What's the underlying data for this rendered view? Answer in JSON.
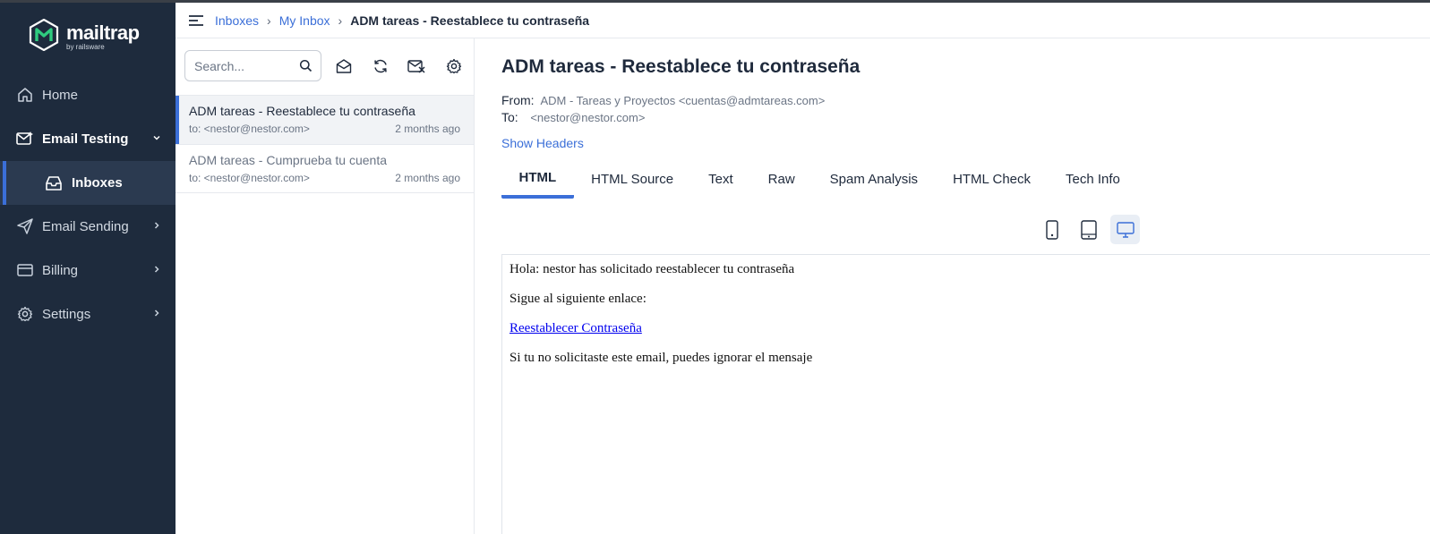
{
  "sidebar": {
    "logo": {
      "name": "mailtrap",
      "sub": "by railsware"
    },
    "items": [
      {
        "label": "Home",
        "icon": "home-icon"
      },
      {
        "label": "Email Testing",
        "icon": "email-testing-icon",
        "expanded": true
      },
      {
        "label": "Inboxes",
        "icon": "inbox-icon",
        "active": true
      },
      {
        "label": "Email Sending",
        "icon": "send-icon"
      },
      {
        "label": "Billing",
        "icon": "billing-icon"
      },
      {
        "label": "Settings",
        "icon": "gear-icon"
      }
    ]
  },
  "breadcrumb": {
    "items": [
      "Inboxes",
      "My Inbox",
      "ADM tareas - Reestablece tu contraseña"
    ],
    "separator": "›"
  },
  "list": {
    "search_placeholder": "Search...",
    "messages": [
      {
        "subject": "ADM tareas - Reestablece tu contraseña",
        "to": "to: <nestor@nestor.com>",
        "time": "2 months ago",
        "active": true
      },
      {
        "subject": "ADM tareas - Cumprueba tu cuenta",
        "to": "to: <nestor@nestor.com>",
        "time": "2 months ago",
        "active": false
      }
    ]
  },
  "message": {
    "title": "ADM tareas - Reestablece tu contraseña",
    "from_label": "From:",
    "from_value": "ADM - Tareas y Proyectos <cuentas@admtareas.com>",
    "to_label": "To:",
    "to_value": "<nestor@nestor.com>",
    "show_headers": "Show Headers",
    "tabs": [
      "HTML",
      "HTML Source",
      "Text",
      "Raw",
      "Spam Analysis",
      "HTML Check",
      "Tech Info"
    ],
    "active_tab": "HTML",
    "preview": {
      "greeting": "Hola: nestor has solicitado reestablecer tu contraseña",
      "instruction": "Sigue al siguiente enlace:",
      "link": "Reestablecer Contraseña",
      "footer": "Si tu no solicitaste este email, puedes ignorar el mensaje"
    }
  },
  "colors": {
    "sidebar_bg": "#1e2b3d",
    "accent": "#3b6fd8",
    "logo_green": "#2fcb7f"
  }
}
